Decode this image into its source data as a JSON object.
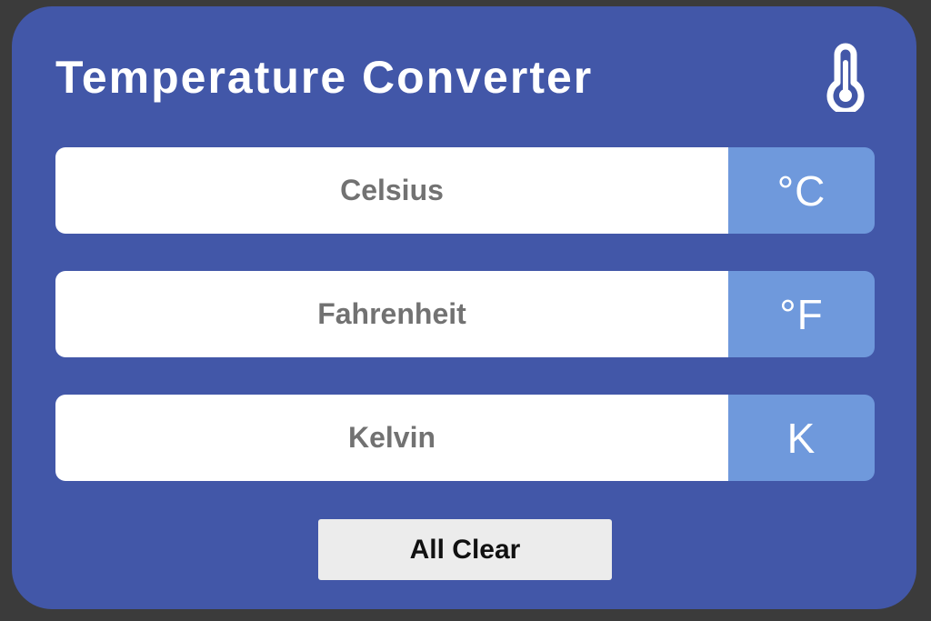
{
  "header": {
    "title": "Temperature Converter",
    "icon": "thermometer-icon"
  },
  "fields": [
    {
      "placeholder": "Celsius",
      "value": "",
      "unit": "°C"
    },
    {
      "placeholder": "Fahrenheit",
      "value": "",
      "unit": "°F"
    },
    {
      "placeholder": "Kelvin",
      "value": "",
      "unit": "K"
    }
  ],
  "actions": {
    "clear_label": "All Clear"
  },
  "colors": {
    "card_background": "#4257a8",
    "unit_background": "#6f99dc",
    "field_background": "#ffffff",
    "button_background": "#ececec",
    "title_text": "#ffffff"
  }
}
